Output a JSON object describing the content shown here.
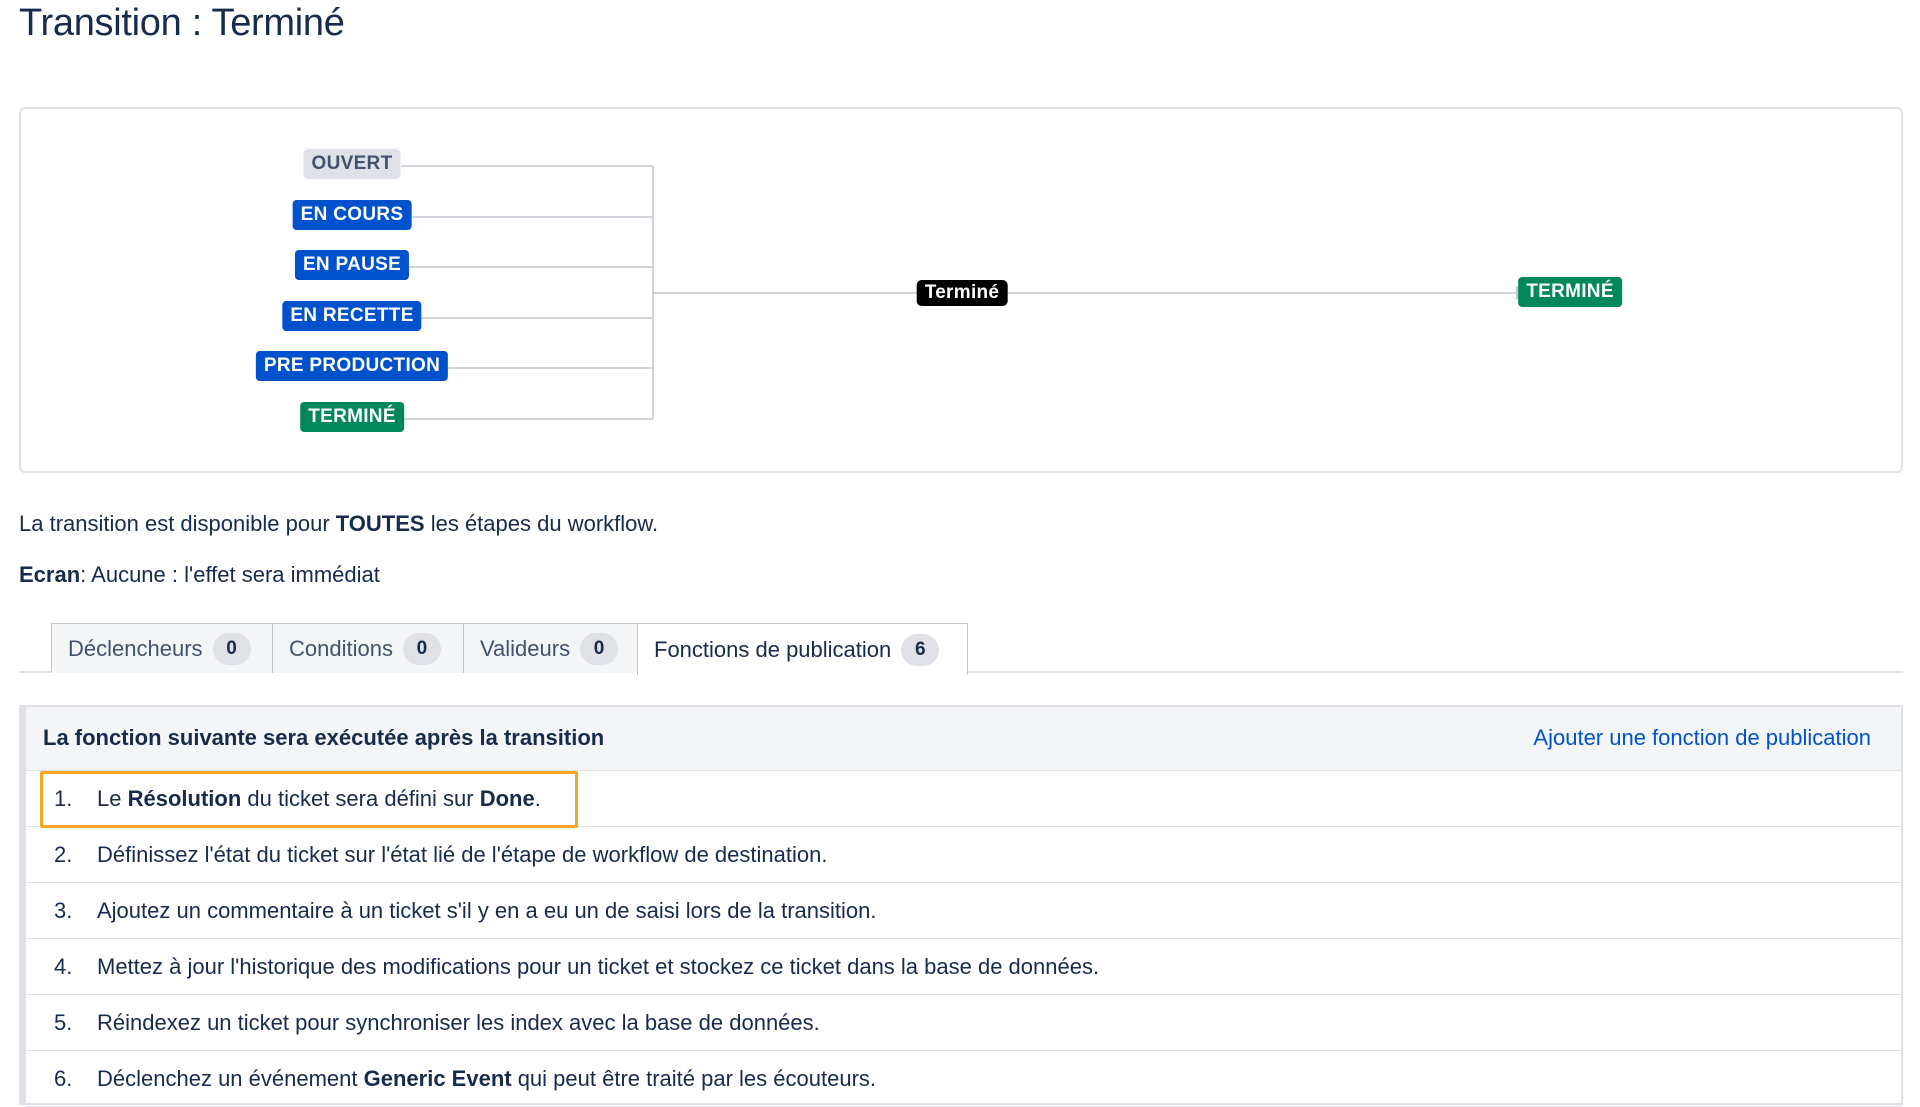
{
  "page": {
    "title": "Transition : Terminé"
  },
  "diagram": {
    "source_statuses": [
      {
        "label": "OUVERT",
        "color": "#dfe1e6"
      },
      {
        "label": "EN COURS",
        "color": "#0052cc"
      },
      {
        "label": "EN PAUSE",
        "color": "#0052cc"
      },
      {
        "label": "EN RECETTE",
        "color": "#0052cc"
      },
      {
        "label": "PRE PRODUCTION",
        "color": "#0052cc"
      },
      {
        "label": "TERMINÉ",
        "color": "#00875a"
      }
    ],
    "transition_label": "Terminé",
    "target_status": {
      "label": "TERMINÉ",
      "color": "#00875a"
    }
  },
  "info": {
    "availability_prefix": "La transition est disponible pour ",
    "availability_bold": "TOUTES",
    "availability_suffix": " les étapes du workflow.",
    "screen_label": "Ecran",
    "screen_value": ": Aucune : l'effet sera immédiat"
  },
  "tabs": [
    {
      "label": "Déclencheurs",
      "count": "0"
    },
    {
      "label": "Conditions",
      "count": "0"
    },
    {
      "label": "Valideurs",
      "count": "0"
    },
    {
      "label": "Fonctions de publication",
      "count": "6",
      "active": true
    }
  ],
  "panel": {
    "title": "La fonction suivante sera exécutée après la transition",
    "add_link": "Ajouter une fonction de publication",
    "rows": [
      {
        "num": "1.",
        "parts": [
          "Le ",
          "Résolution",
          " du ticket sera défini sur ",
          "Done",
          "."
        ]
      },
      {
        "num": "2.",
        "text": "Définissez l'état du ticket sur l'état lié de l'étape de workflow de destination."
      },
      {
        "num": "3.",
        "text": "Ajoutez un commentaire à un ticket s'il y en a eu un de saisi lors de la transition."
      },
      {
        "num": "4.",
        "text": "Mettez à jour l'historique des modifications pour un ticket et stockez ce ticket dans la base de données."
      },
      {
        "num": "5.",
        "text": "Réindexez un ticket pour synchroniser les index avec la base de données."
      },
      {
        "num": "6.",
        "parts": [
          "Déclenchez un événement ",
          "Generic Event",
          " qui peut être traité par les écouteurs."
        ]
      }
    ]
  },
  "colors": {
    "highlight": "#f5a623",
    "link": "#0052cc"
  }
}
